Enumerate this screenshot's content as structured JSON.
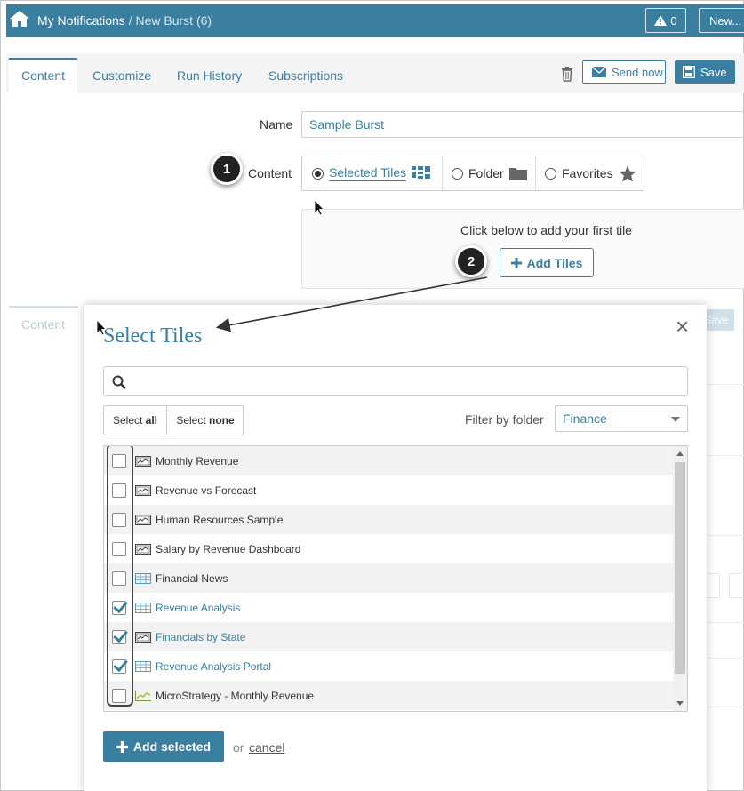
{
  "header": {
    "breadcrumb_root": "My Notifications",
    "breadcrumb_sep": " / ",
    "breadcrumb_current": "New Burst (6)",
    "alert_count": "0",
    "new_label": "New..."
  },
  "tabs": [
    {
      "label": "Content",
      "active": true
    },
    {
      "label": "Customize"
    },
    {
      "label": "Run History"
    },
    {
      "label": "Subscriptions"
    }
  ],
  "toolbar": {
    "send_now": "Send now",
    "save": "Save"
  },
  "form": {
    "name_label": "Name",
    "name_value": "Sample Burst",
    "content_label": "Content",
    "content_options": [
      {
        "label": "Selected Tiles",
        "selected": true
      },
      {
        "label": "Folder"
      },
      {
        "label": "Favorites"
      }
    ],
    "tile_hint": "Click below to add your first tile",
    "add_tiles": "Add Tiles"
  },
  "ghost": {
    "tab": "Content",
    "save": "Save"
  },
  "badges": [
    "1",
    "2"
  ],
  "modal": {
    "title": "Select Tiles",
    "select_all_prefix": "Select ",
    "select_all_bold": "all",
    "select_none_prefix": "Select ",
    "select_none_bold": "none",
    "filter_label": "Filter by folder",
    "filter_value": "Finance",
    "tiles": [
      {
        "label": "Monthly Revenue",
        "checked": false,
        "icon": "dashboard-icon"
      },
      {
        "label": "Revenue vs Forecast",
        "checked": false,
        "icon": "dashboard-icon"
      },
      {
        "label": "Human Resources Sample",
        "checked": false,
        "icon": "dashboard-icon"
      },
      {
        "label": "Salary by Revenue Dashboard",
        "checked": false,
        "icon": "dashboard-icon"
      },
      {
        "label": "Financial News",
        "checked": false,
        "icon": "table-icon"
      },
      {
        "label": "Revenue Analysis",
        "checked": true,
        "icon": "table-icon"
      },
      {
        "label": "Financials by State",
        "checked": true,
        "icon": "dashboard-icon"
      },
      {
        "label": "Revenue Analysis Portal",
        "checked": true,
        "icon": "table-icon"
      },
      {
        "label": "MicroStrategy - Monthly Revenue",
        "checked": false,
        "icon": "line-chart-icon"
      }
    ],
    "add_selected": "Add selected",
    "or": "or",
    "cancel": "cancel"
  },
  "colors": {
    "accent": "#3a7fa0",
    "header_bg": "#3a7fa0"
  }
}
